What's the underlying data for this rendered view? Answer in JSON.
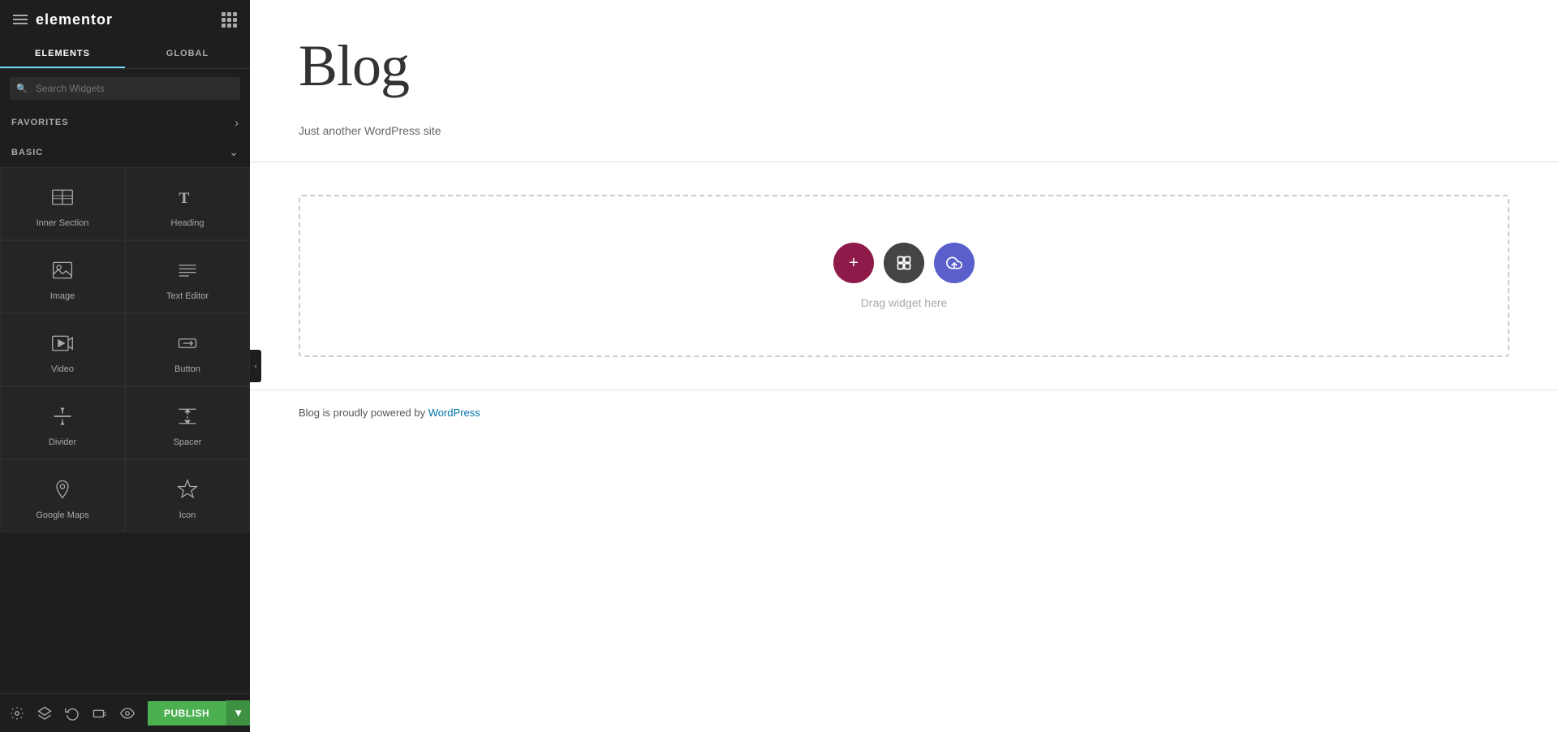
{
  "sidebar": {
    "logo": "elementor",
    "tabs": [
      {
        "id": "elements",
        "label": "ELEMENTS",
        "active": true
      },
      {
        "id": "global",
        "label": "GLOBAL",
        "active": false
      }
    ],
    "search": {
      "placeholder": "Search Widgets"
    },
    "sections": [
      {
        "id": "favorites",
        "label": "FAVORITES",
        "collapsed": true
      },
      {
        "id": "basic",
        "label": "BASIC",
        "collapsed": false,
        "widgets": [
          {
            "id": "inner-section",
            "label": "Inner Section",
            "icon": "inner-section-icon"
          },
          {
            "id": "heading",
            "label": "Heading",
            "icon": "heading-icon"
          },
          {
            "id": "image",
            "label": "Image",
            "icon": "image-icon"
          },
          {
            "id": "text-editor",
            "label": "Text Editor",
            "icon": "text-editor-icon"
          },
          {
            "id": "video",
            "label": "Video",
            "icon": "video-icon"
          },
          {
            "id": "button",
            "label": "Button",
            "icon": "button-icon"
          },
          {
            "id": "divider",
            "label": "Divider",
            "icon": "divider-icon"
          },
          {
            "id": "spacer",
            "label": "Spacer",
            "icon": "spacer-icon"
          },
          {
            "id": "google-maps",
            "label": "Google Maps",
            "icon": "google-maps-icon"
          },
          {
            "id": "icon",
            "label": "Icon",
            "icon": "icon-widget-icon"
          }
        ]
      }
    ],
    "bottom_toolbar": {
      "settings_icon": "⚙",
      "layers_icon": "◧",
      "history_icon": "↺",
      "responsive_icon": "▭",
      "preview_icon": "👁",
      "publish_label": "PUBLISH"
    }
  },
  "canvas": {
    "blog_title": "Blog",
    "blog_subtitle": "Just another WordPress site",
    "drop_zone": {
      "label": "Drag widget here",
      "btn_plus": "+",
      "btn_folder": "■",
      "btn_cloud": "☁"
    },
    "footer_text": "Blog is proudly powered by ",
    "footer_link": "WordPress"
  }
}
